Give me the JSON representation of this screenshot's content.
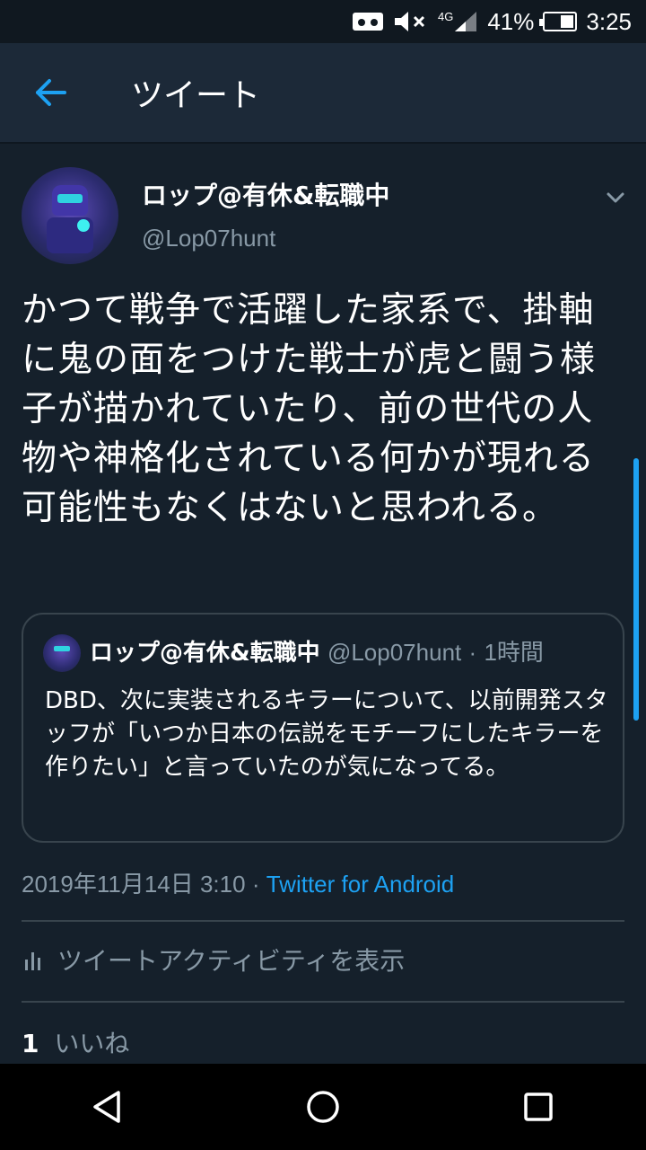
{
  "status_bar": {
    "network": "4G",
    "battery_percent": "41%",
    "battery_level": 0.41,
    "time": "3:25"
  },
  "header": {
    "title": "ツイート"
  },
  "tweet": {
    "display_name": "ロップ@有休&転職中",
    "handle": "@Lop07hunt",
    "text": "かつて戦争で活躍した家系で、掛軸に鬼の面をつけた戦士が虎と闘う様子が描かれていたり、前の世代の人物や神格化されている何かが現れる可能性もなくはないと思われる。",
    "timestamp": "2019年11月14日 3:10",
    "separator": "·",
    "source": "Twitter for Android",
    "activity_label": "ツイートアクティビティを表示",
    "likes_count": "1",
    "likes_label": "いいね"
  },
  "quoted_tweet": {
    "display_name": "ロップ@有休&転職中",
    "handle": "@Lop07hunt",
    "separator": "·",
    "time": "1時間",
    "text": "DBD、次に実装されるキラーについて、以前開発スタッフが「いつか日本の伝説をモチーフにしたキラーを作りたい」と言っていたのが気になってる。"
  },
  "colors": {
    "background": "#15202b",
    "header": "#1c2938",
    "accent": "#1da1f2",
    "muted": "#8899a6",
    "border": "#38444d"
  },
  "icons": {
    "back": "arrow-left-icon",
    "menu": "chevron-down-icon",
    "activity": "bar-chart-icon",
    "nav": [
      "back-triangle-icon",
      "home-circle-icon",
      "recents-square-icon"
    ]
  }
}
